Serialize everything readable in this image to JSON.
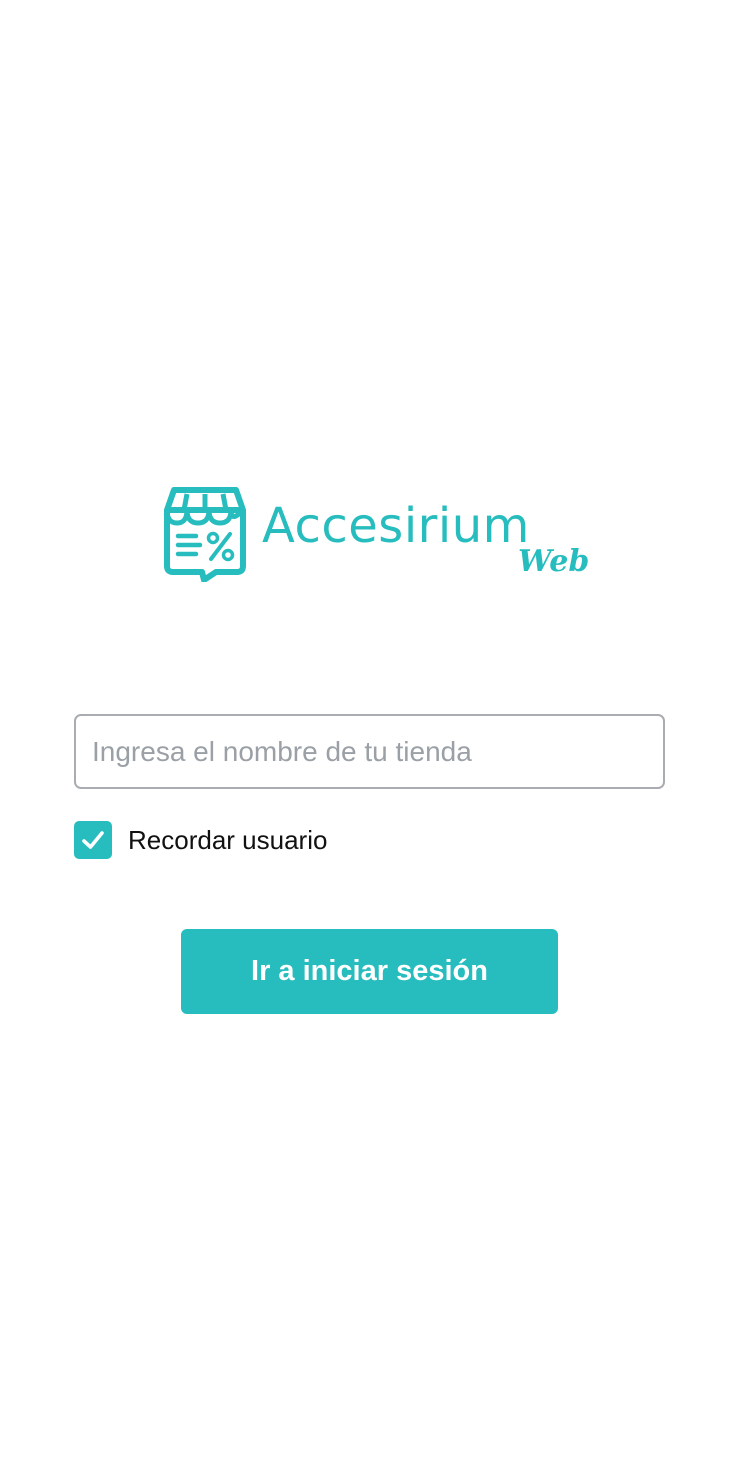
{
  "logo": {
    "name": "Accesirium",
    "subname": "Web",
    "icon": "store-percent-icon",
    "color": "#27bcbd"
  },
  "form": {
    "store_input": {
      "value": "",
      "placeholder": "Ingresa el nombre de tu tienda"
    },
    "remember": {
      "label": "Recordar usuario",
      "checked": true,
      "icon": "checkmark-icon"
    },
    "submit_label": "Ir a iniciar sesión"
  },
  "colors": {
    "accent": "#27bcbd",
    "input_border": "#a9adb1",
    "placeholder": "#9aa0a6",
    "text": "#111111"
  }
}
